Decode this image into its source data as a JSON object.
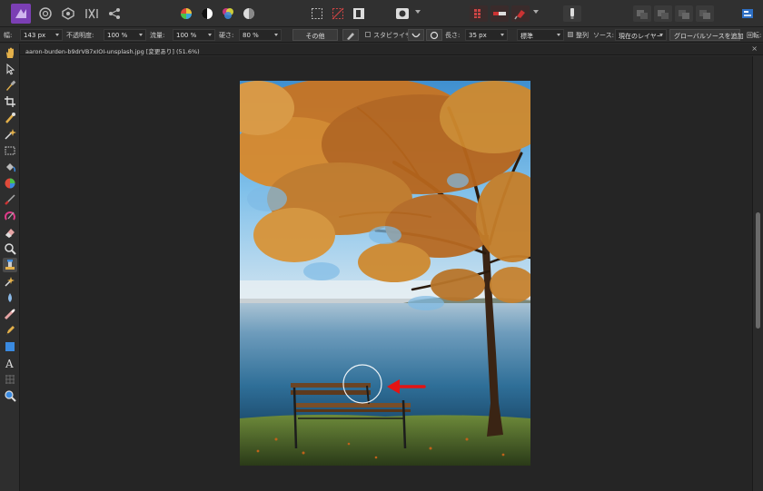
{
  "context_bar": {
    "width_label": "幅:",
    "width_value": "143 px",
    "opacity_label": "不透明度:",
    "opacity_value": "100 %",
    "flow_label": "流量:",
    "flow_value": "100 %",
    "hardness_label": "硬さ:",
    "hardness_value": "80 %",
    "more_button": "その他",
    "stabilizer_label": "スタビライザ",
    "length_label": "長さ:",
    "length_value": "35 px",
    "mode_value": "標準",
    "aligned_label": "整列",
    "source_label": "ソース:",
    "source_value": "現在のレイヤー",
    "add_global_source_button": "グローバルソースを追加",
    "rotate_label": "回転:"
  },
  "document": {
    "tab_title": "aaron-burden-b9drVB7xIOI-unsplash.jpg [変更あり] (51.6%)",
    "close_glyph": "×"
  },
  "colors": {
    "app_bg": "#2b2b2b",
    "canvas_bg": "#252525",
    "brush_cursor": "#ffffff",
    "annotation_arrow": "#e41414",
    "logo_purple": "#7b3fb4"
  },
  "icons": {
    "toolbar": [
      "affinity-photo-logo",
      "photo-persona-icon",
      "liquify-persona-icon",
      "develop-persona-icon",
      "tone-mapping-persona-icon",
      "export-persona-icon",
      "color-wheel-icon",
      "contrast-icon",
      "rgb-channels-icon",
      "white-balance-icon",
      "marquee-selection-icon",
      "no-selection-icon",
      "invert-selection-icon",
      "quick-mask-icon",
      "snapping-grid-icon",
      "snapping-toggle-icon",
      "snapping-magnet-icon",
      "assistant-icon",
      "arrange-front-icon",
      "arrange-forward-icon",
      "arrange-backward-icon",
      "arrange-back-icon",
      "studio-toggle-icon"
    ],
    "tools": [
      "hand-icon",
      "move-icon",
      "color-picker-icon",
      "crop-icon",
      "selection-brush-icon",
      "flood-select-icon",
      "rectangular-marquee-icon",
      "flood-fill-icon",
      "gradient-icon",
      "paint-brush-icon",
      "color-replacement-icon",
      "erase-brush-icon",
      "dodge-icon",
      "clone-brush-icon",
      "healing-brush-icon",
      "blur-brush-icon",
      "smudge-brush-icon",
      "pen-icon",
      "vector-brush-icon",
      "rectangle-shape-icon",
      "artistic-text-icon",
      "mesh-warp-icon",
      "zoom-icon"
    ]
  }
}
